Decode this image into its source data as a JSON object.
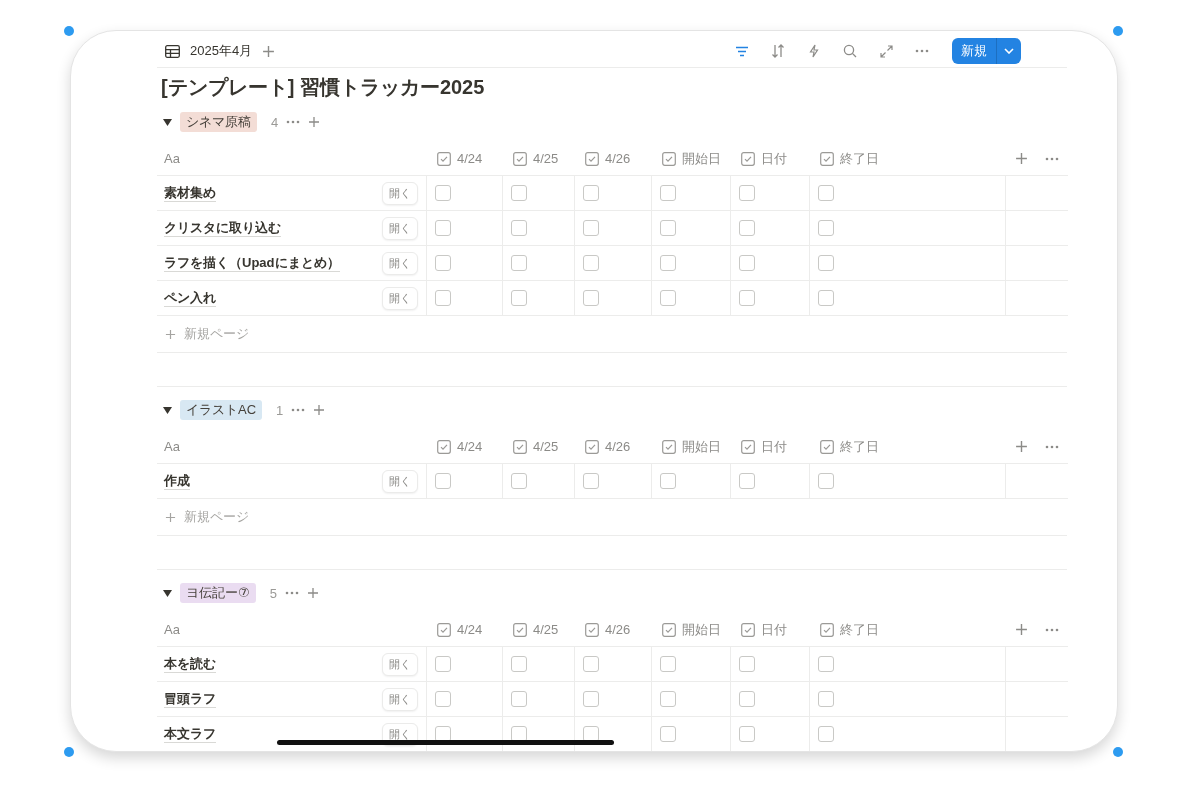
{
  "toolbar": {
    "view_name": "2025年4月",
    "new_button": "新規"
  },
  "title": "[テンプレート] 習慣トラッカー2025",
  "groups": [
    {
      "tag": "シネマ原稿",
      "color": "#f3ddd6",
      "count": "4",
      "expanded": true,
      "name_header": "Aa",
      "columns": [
        "4/24",
        "4/25",
        "4/26",
        "開始日",
        "日付",
        "終了日"
      ],
      "rows": [
        {
          "name": "素材集め",
          "open": "開く",
          "cells": [
            {
              "checked": false
            },
            {
              "checked": false
            },
            {
              "checked": false
            },
            {
              "checked": false
            },
            {
              "checked": false
            },
            {
              "checked": false
            }
          ]
        },
        {
          "name": "クリスタに取り込む",
          "open": "開く",
          "cells": [
            {
              "checked": false
            },
            {
              "checked": false
            },
            {
              "checked": false
            },
            {
              "checked": false
            },
            {
              "checked": false
            },
            {
              "checked": false
            }
          ]
        },
        {
          "name": "ラフを描く（Upadにまとめ）",
          "open": "開く",
          "cells": [
            {
              "checked": false
            },
            {
              "checked": false
            },
            {
              "checked": false
            },
            {
              "checked": false
            },
            {
              "checked": false
            },
            {
              "checked": false
            }
          ]
        },
        {
          "name": "ペン入れ",
          "open": "開く",
          "cells": [
            {
              "checked": false
            },
            {
              "checked": false
            },
            {
              "checked": false
            },
            {
              "checked": false
            },
            {
              "checked": false
            },
            {
              "checked": false
            }
          ]
        }
      ],
      "new_page": "新規ページ"
    },
    {
      "tag": "イラストAC",
      "color": "#d8e8f3",
      "count": "1",
      "expanded": true,
      "name_header": "Aa",
      "columns": [
        "4/24",
        "4/25",
        "4/26",
        "開始日",
        "日付",
        "終了日"
      ],
      "rows": [
        {
          "name": "作成",
          "open": "開く",
          "cells": [
            {
              "checked": false
            },
            {
              "checked": false
            },
            {
              "checked": false
            },
            {
              "checked": false
            },
            {
              "checked": false
            },
            {
              "checked": false
            }
          ]
        }
      ],
      "new_page": "新規ページ"
    },
    {
      "tag": "ヨ伝記ー⑦",
      "color": "#eadcf1",
      "count": "5",
      "expanded": true,
      "name_header": "Aa",
      "columns": [
        "4/24",
        "4/25",
        "4/26",
        "開始日",
        "日付",
        "終了日"
      ],
      "rows": [
        {
          "name": "本を読む",
          "open": "開く",
          "cells": [
            {
              "checked": false
            },
            {
              "checked": false
            },
            {
              "checked": false
            },
            {
              "checked": false
            },
            {
              "checked": false
            },
            {
              "checked": false
            }
          ]
        },
        {
          "name": "冒頭ラフ",
          "open": "開く",
          "cells": [
            {
              "checked": false
            },
            {
              "checked": false
            },
            {
              "checked": false
            },
            {
              "checked": false
            },
            {
              "checked": false
            },
            {
              "checked": false
            }
          ]
        },
        {
          "name": "本文ラフ",
          "open": "開く",
          "cells": [
            {
              "checked": false
            },
            {
              "checked": false
            },
            {
              "checked": false
            },
            {
              "checked": false
            },
            {
              "checked": false
            },
            {
              "checked": false
            }
          ]
        }
      ]
    }
  ]
}
